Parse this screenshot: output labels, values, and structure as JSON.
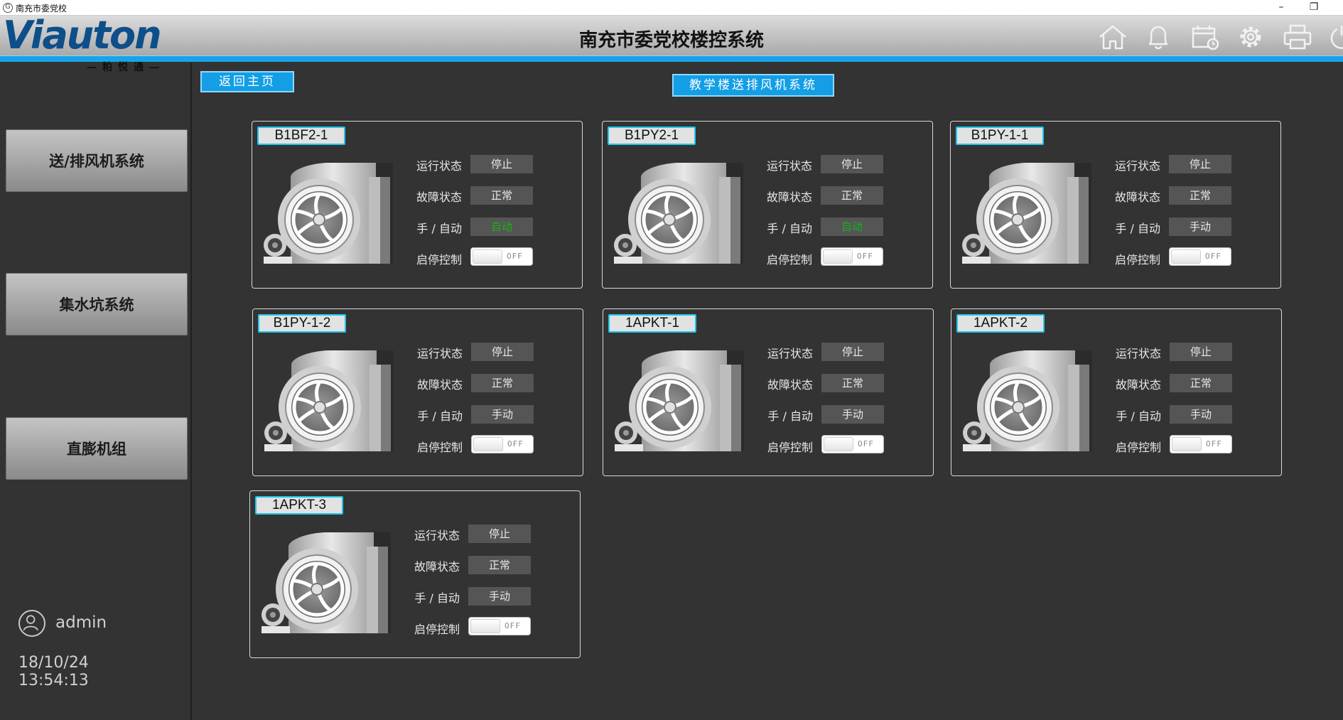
{
  "window": {
    "title": "南充市委党校",
    "minimize": "–",
    "restore": "❐"
  },
  "header": {
    "logo_text": "Viauton",
    "logo_sub": "—粕悦通—",
    "title": "南充市委党校楼控系统",
    "icons": [
      "home-icon",
      "bell-icon",
      "calendar-icon",
      "gear-icon",
      "printer-icon",
      "power-icon"
    ],
    "accent": "#1aa3e6"
  },
  "sidebar": {
    "items": [
      {
        "label": "送/排风机系统"
      },
      {
        "label": "集水坑系统"
      },
      {
        "label": "直膨机组"
      }
    ],
    "user": "admin",
    "date": "18/10/24",
    "time": "13:54:13"
  },
  "main": {
    "back_label": "返回主页",
    "heading": "教学楼送排风机系统",
    "labels": {
      "run": "运行状态",
      "fault": "故障状态",
      "mode": "手 / 自动",
      "ctrl": "启停控制"
    },
    "fans": [
      {
        "name": "B1BF2-1",
        "run": "停止",
        "fault": "正常",
        "mode": "自动",
        "toggle": "OFF"
      },
      {
        "name": "B1PY2-1",
        "run": "停止",
        "fault": "正常",
        "mode": "自动",
        "toggle": "OFF"
      },
      {
        "name": "B1PY-1-1",
        "run": "停止",
        "fault": "正常",
        "mode": "手动",
        "toggle": "OFF"
      },
      {
        "name": "B1PY-1-2",
        "run": "停止",
        "fault": "正常",
        "mode": "手动",
        "toggle": "OFF"
      },
      {
        "name": "1APKT-1",
        "run": "停止",
        "fault": "正常",
        "mode": "手动",
        "toggle": "OFF"
      },
      {
        "name": "1APKT-2",
        "run": "停止",
        "fault": "正常",
        "mode": "手动",
        "toggle": "OFF"
      },
      {
        "name": "1APKT-3",
        "run": "停止",
        "fault": "正常",
        "mode": "手动",
        "toggle": "OFF"
      }
    ],
    "colors": {
      "auto_text": "#19b219",
      "tag_border": "#1ec7ea"
    }
  }
}
